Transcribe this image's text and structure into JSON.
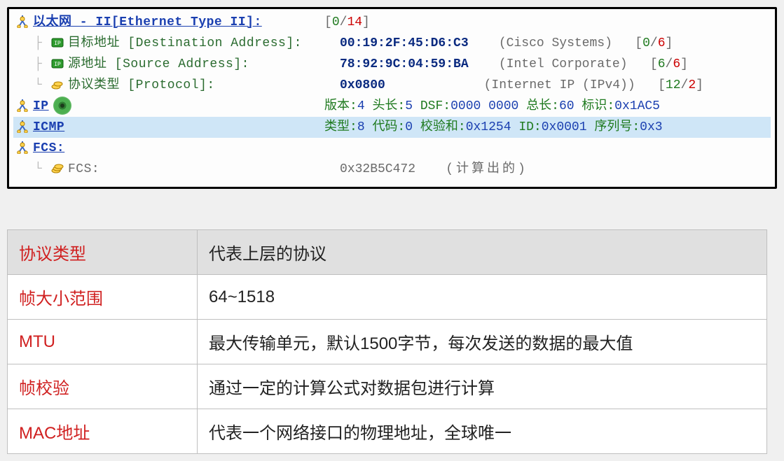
{
  "ethernet": {
    "title": "以太网 - II[Ethernet Type II]:",
    "counter": "[0/14]",
    "dest": {
      "label": "目标地址 [Destination Address]:",
      "value": "00:19:2F:45:D6:C3",
      "vendor": "(Cisco Systems)",
      "counter_a": "0",
      "counter_b": "6"
    },
    "src": {
      "label": "源地址 [Source Address]:",
      "value": "78:92:9C:04:59:BA",
      "vendor": "(Intel Corporate)",
      "counter_a": "6",
      "counter_b": "6"
    },
    "proto": {
      "label": "协议类型 [Protocol]:",
      "value": "0x0800",
      "vendor": "(Internet IP (IPv4))",
      "counter_a": "12",
      "counter_b": "2"
    }
  },
  "ip": {
    "title": "IP",
    "detail_prefix_version": "版本:",
    "version": "4",
    "hlen_label": " 头长:",
    "hlen": "5",
    "dsf_label": " DSF:",
    "dsf": "0000 0000",
    "totlen_label": " 总长:",
    "totlen": "60",
    "id_label": " 标识:",
    "id": "0x1AC5"
  },
  "icmp": {
    "title": "ICMP",
    "type_label": "类型:",
    "type": "8",
    "code_label": " 代码:",
    "code": "0",
    "chk_label": " 校验和:",
    "chk": "0x1254",
    "id_label": " ID:",
    "id": "0x0001",
    "seq_label": " 序列号:",
    "seq": "0x3"
  },
  "fcs": {
    "title": "FCS:",
    "label": "FCS:",
    "value": "0x32B5C472",
    "note": "(计算出的)"
  },
  "table": {
    "header_k": "协议类型",
    "header_v": "代表上层的协议",
    "rows": [
      {
        "k": "帧大小范围",
        "v": "64~1518"
      },
      {
        "k": "MTU",
        "v": "最大传输单元，默认1500字节，每次发送的数据的最大值"
      },
      {
        "k": "帧校验",
        "v": "通过一定的计算公式对数据包进行计算"
      },
      {
        "k": "MAC地址",
        "v": "代表一个网络接口的物理地址，全球唯一"
      }
    ]
  }
}
